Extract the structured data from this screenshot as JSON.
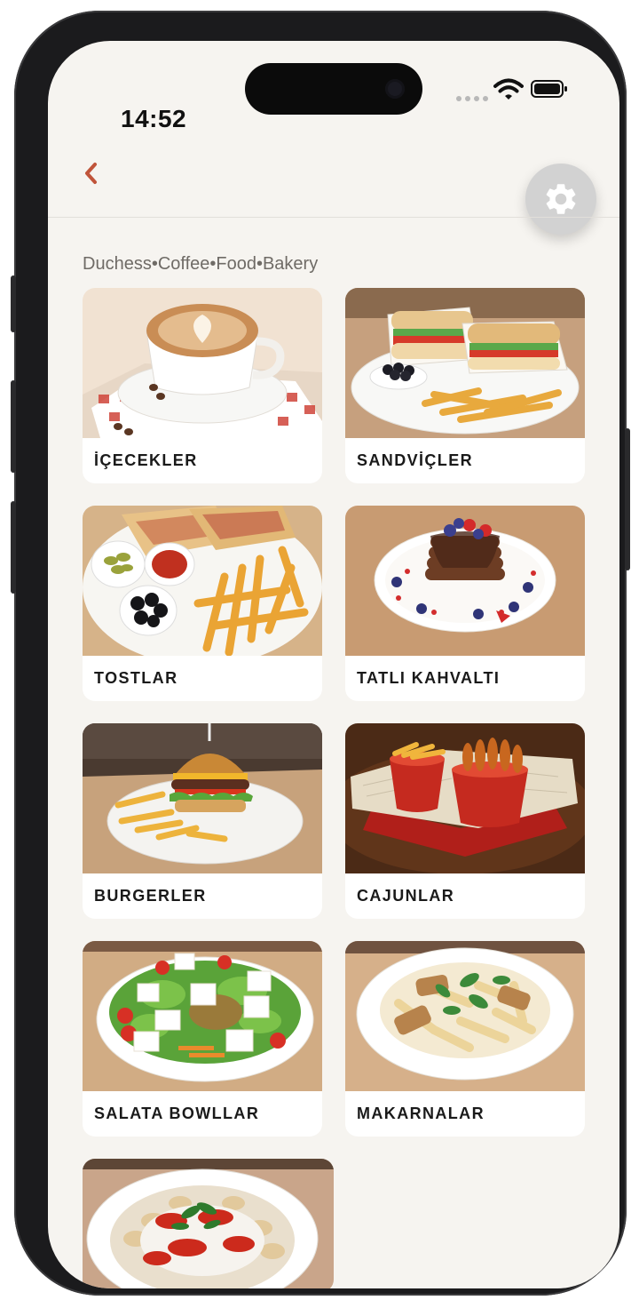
{
  "status_bar": {
    "time": "14:52"
  },
  "header": {
    "back_icon": "chevron-left-icon",
    "settings_icon": "gear-icon"
  },
  "brand": {
    "name": "Duchess•Coffee•Food•Bakery"
  },
  "categories": [
    {
      "label": "İÇECEKLER"
    },
    {
      "label": "SANDVİÇLER"
    },
    {
      "label": "TOSTLAR"
    },
    {
      "label": "TATLI KAHVALTI"
    },
    {
      "label": "BURGERLER"
    },
    {
      "label": "CAJUNLAR"
    },
    {
      "label": "SALATA BOWLLAR"
    },
    {
      "label": "MAKARNALAR"
    }
  ],
  "colors": {
    "accent": "#c0543a",
    "background": "#f6f4f0",
    "card": "#ffffff"
  }
}
